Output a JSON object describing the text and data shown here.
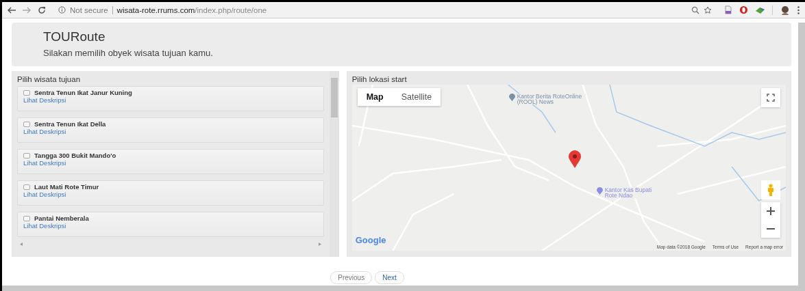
{
  "browser": {
    "security_label": "Not secure",
    "url_host": "wisata-rote.rrums.com",
    "url_path": "/index.php/route/one"
  },
  "header": {
    "title": "TOURoute",
    "subtitle": "Silakan memilih obyek wisata tujuan kamu."
  },
  "destinations": {
    "title": "Pilih wisata tujuan",
    "items": [
      {
        "name": "Sentra Tenun Ikat Janur Kuning",
        "checked": false,
        "link": "Lihat Deskripsi"
      },
      {
        "name": "Sentra Tenun Ikat Della",
        "checked": false,
        "link": "Lihat Deskripsi"
      },
      {
        "name": "Tangga 300 Bukit Mando'o",
        "checked": false,
        "link": "Lihat Deskripsi"
      },
      {
        "name": "Laut Mati Rote Timur",
        "checked": false,
        "link": "Lihat Deskripsi"
      },
      {
        "name": "Pantai Nemberala",
        "checked": false,
        "link": "Lihat Deskripsi"
      }
    ]
  },
  "map": {
    "title": "Pilih lokasi start",
    "map_types": [
      {
        "label": "Map",
        "selected": true
      },
      {
        "label": "Satellite",
        "selected": false
      }
    ],
    "places": [
      {
        "label": "Kantor Berita RoteOnline (ROOL) News",
        "color": "#7b8fa6"
      },
      {
        "label": "Kantor Kas Bupati Rote Ndao",
        "color": "#8a8ee0"
      }
    ],
    "logo": "Google",
    "attribution": [
      "Map data ©2018 Google",
      "Terms of Use",
      "Report a map error"
    ]
  },
  "buttons": [
    {
      "label": "Previous",
      "disabled": true
    },
    {
      "label": "Next",
      "disabled": false
    }
  ]
}
